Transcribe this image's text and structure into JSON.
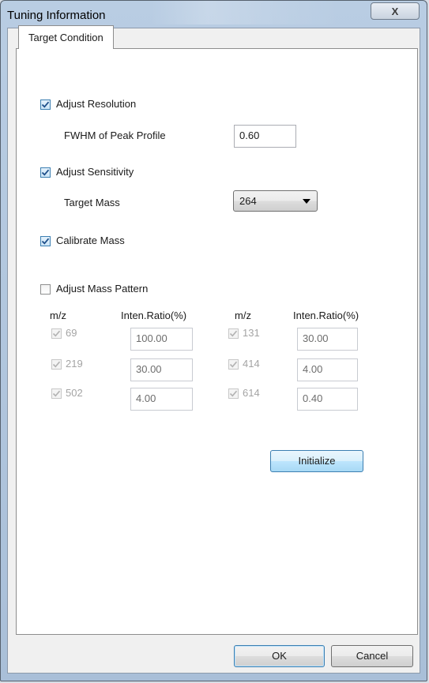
{
  "window": {
    "title": "Tuning Information",
    "close_symbol": "X"
  },
  "tabs": [
    {
      "label": "Target Condition",
      "active": true
    }
  ],
  "resolution": {
    "label": "Adjust Resolution",
    "checked": true,
    "fwhm_label": "FWHM of Peak Profile",
    "fwhm_value": "0.60"
  },
  "sensitivity": {
    "label": "Adjust Sensitivity",
    "checked": true,
    "target_mass_label": "Target Mass",
    "target_mass_value": "264"
  },
  "calibrate": {
    "label": "Calibrate Mass",
    "checked": true
  },
  "mass_pattern": {
    "label": "Adjust Mass Pattern",
    "checked": false,
    "headers": {
      "mz": "m/z",
      "ratio": "Inten.Ratio(%)"
    },
    "rows": [
      {
        "left_mz": "69",
        "left_ratio": "100.00",
        "right_mz": "131",
        "right_ratio": "30.00"
      },
      {
        "left_mz": "219",
        "left_ratio": "30.00",
        "right_mz": "414",
        "right_ratio": "4.00"
      },
      {
        "left_mz": "502",
        "left_ratio": "4.00",
        "right_mz": "614",
        "right_ratio": "0.40"
      }
    ]
  },
  "buttons": {
    "initialize": "Initialize",
    "ok": "OK",
    "cancel": "Cancel"
  },
  "colors": {
    "accent": "#3c7fb1",
    "checkmark": "#1e4f8a",
    "disabled_text": "#a4a4a4"
  }
}
